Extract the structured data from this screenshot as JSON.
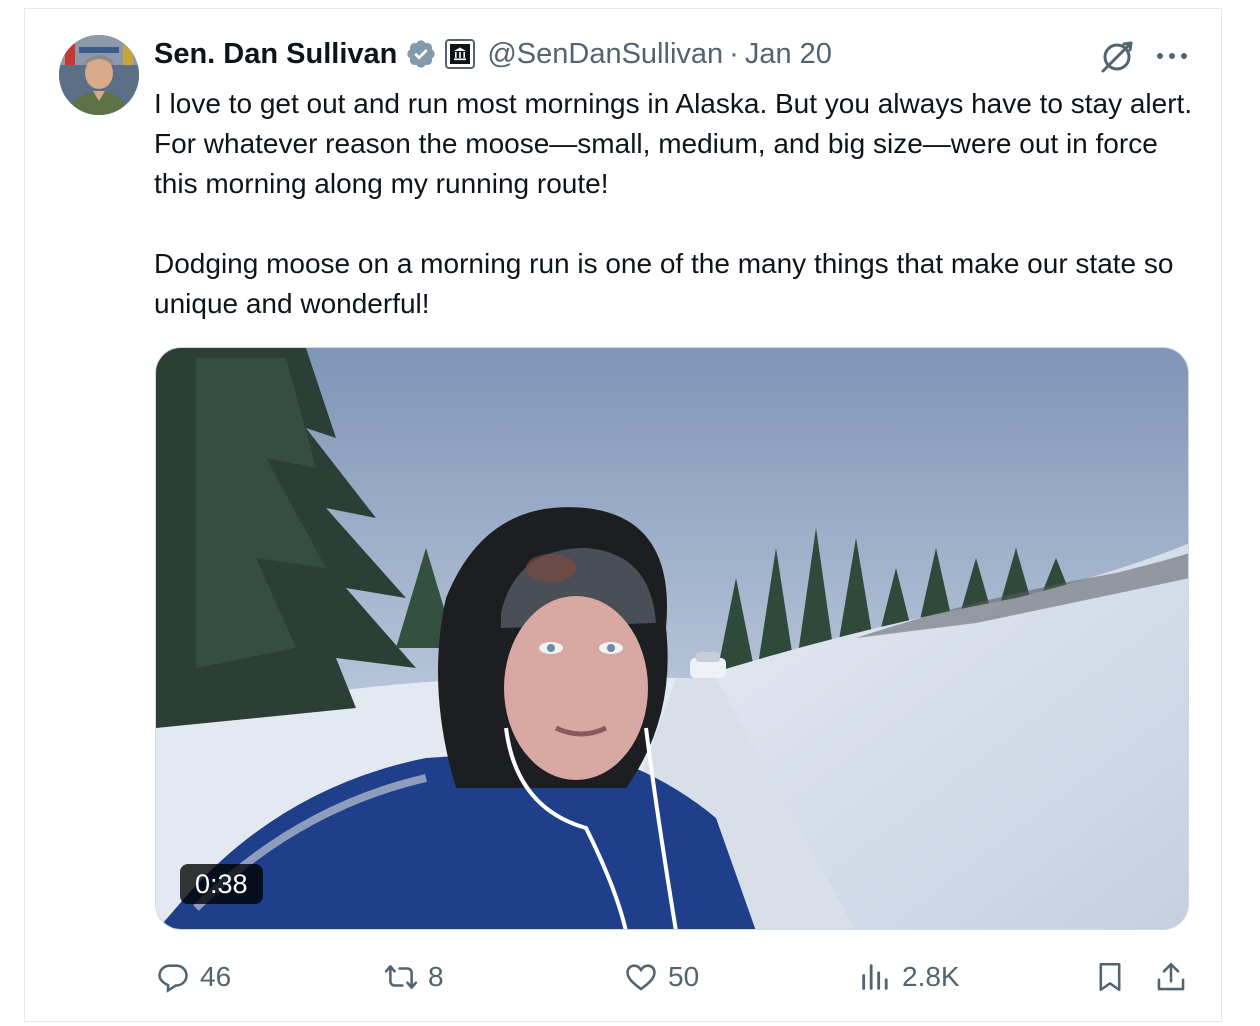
{
  "post": {
    "author_name": "Sen. Dan Sullivan",
    "handle": "@SenDanSullivan",
    "separator": "·",
    "date": "Jan 20",
    "paragraphs": [
      "I love to get out and run most mornings in Alaska. But you always have to stay alert. For whatever reason the moose—small, medium, and big size—were out in force this morning along my running route!",
      "Dodging moose on a morning run is one of the many things that make our state so unique and wonderful!"
    ],
    "video_duration": "0:38"
  },
  "stats": {
    "replies": "46",
    "reposts": "8",
    "likes": "50",
    "views": "2.8K"
  },
  "icons": {
    "verified": "verified-badge-icon",
    "gov": "government-building-icon",
    "grok": "grok-icon",
    "more": "more-icon",
    "reply": "reply-icon",
    "repost": "repost-icon",
    "like": "heart-icon",
    "views": "views-icon",
    "bookmark": "bookmark-icon",
    "share": "share-icon"
  },
  "colors": {
    "text": "#0f1419",
    "secondary": "#536471",
    "verified": "#829aab"
  }
}
